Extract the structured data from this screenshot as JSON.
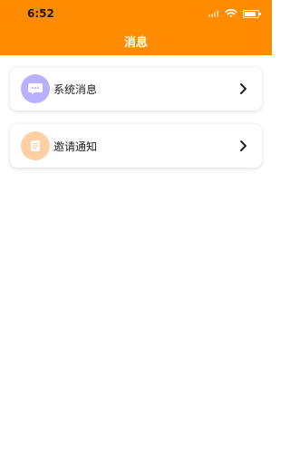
{
  "status_bar": {
    "time": "6:52",
    "icons": [
      "signal-icon",
      "wifi-icon",
      "battery-icon"
    ]
  },
  "header": {
    "title": "消息"
  },
  "list": {
    "items": [
      {
        "label": "系统消息",
        "icon": "chat-bubble-icon",
        "icon_bg": "#B9B0FF"
      },
      {
        "label": "邀请通知",
        "icon": "document-icon",
        "icon_bg": "#FFD0A3"
      }
    ]
  },
  "colors": {
    "header_bg": "#FF8C00",
    "card_bg": "#FFFFFF",
    "text": "#222222",
    "chevron": "#222222"
  }
}
